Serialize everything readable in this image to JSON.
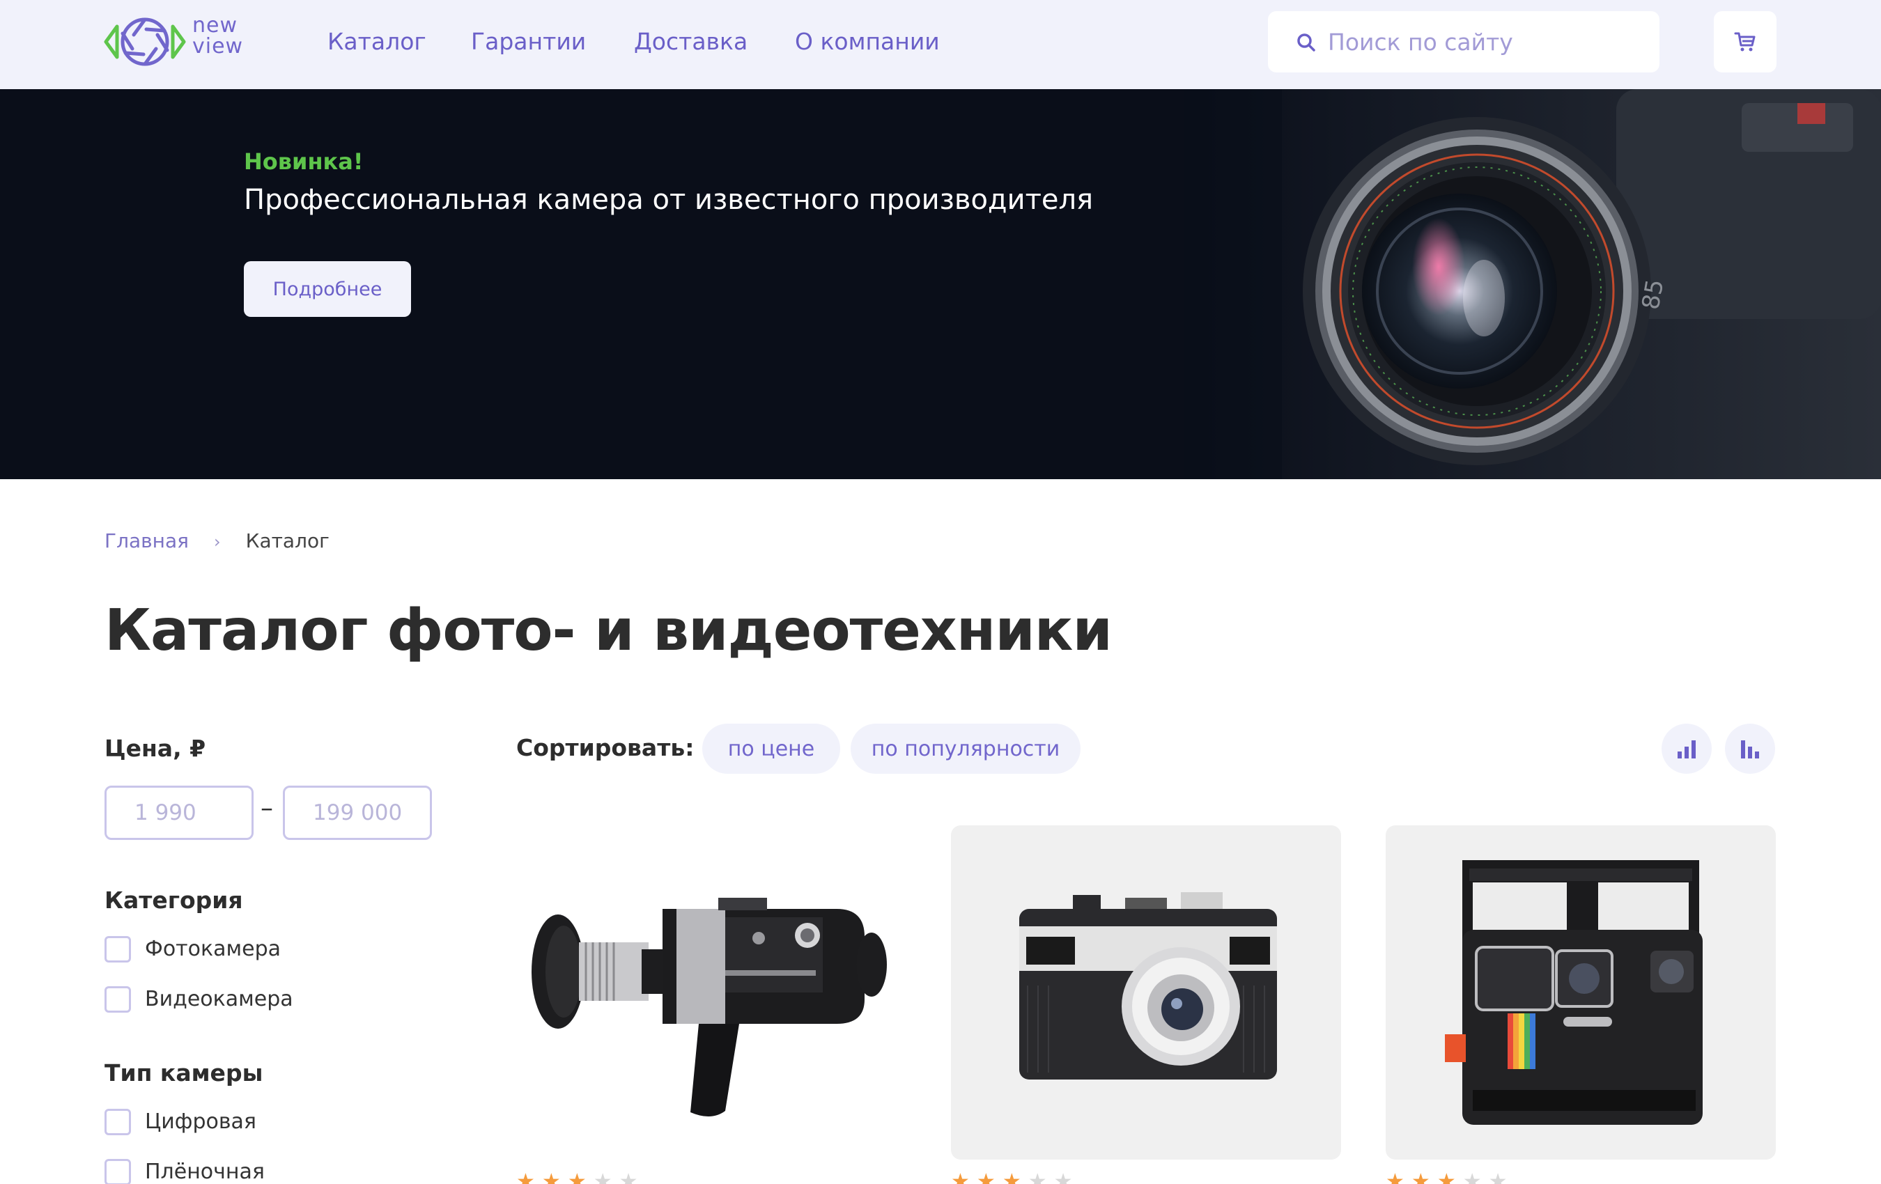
{
  "header": {
    "logo": {
      "line1": "new",
      "line2": "view"
    },
    "nav": [
      {
        "label": "Каталог"
      },
      {
        "label": "Гарантии"
      },
      {
        "label": "Доставка"
      },
      {
        "label": "О компании"
      }
    ],
    "search": {
      "placeholder": "Поиск по сайту",
      "icon": "search-icon"
    },
    "cart": {
      "icon": "cart-icon"
    }
  },
  "hero": {
    "label": "Новинка!",
    "title": "Профессиональная камера от известного производителя",
    "button": "Подробнее",
    "lens_marking": "85"
  },
  "breadcrumb": {
    "home": "Главная",
    "separator": "›",
    "current": "Каталог"
  },
  "page_title": "Каталог фото- и видеотехники",
  "filters": {
    "price": {
      "heading": "Цена, ₽",
      "min_placeholder": "1 990",
      "max_placeholder": "199 000",
      "dash": "–"
    },
    "category": {
      "heading": "Категория",
      "options": [
        {
          "label": "Фотокамера",
          "checked": false
        },
        {
          "label": "Видеокамера",
          "checked": false
        }
      ]
    },
    "camera_type": {
      "heading": "Тип камеры",
      "options": [
        {
          "label": "Цифровая",
          "checked": false
        },
        {
          "label": "Плёночная",
          "checked": false
        }
      ]
    }
  },
  "sort": {
    "label": "Сортировать:",
    "options": [
      {
        "label": "по цене"
      },
      {
        "label": "по популярности"
      }
    ],
    "view_buttons": [
      {
        "icon": "sort-ascending-bars-icon"
      },
      {
        "icon": "sort-descending-bars-icon"
      }
    ]
  },
  "products": [
    {
      "image": "vintage-movie-camera",
      "rating": 3,
      "max_rating": 5
    },
    {
      "image": "compact-film-camera",
      "rating": 3,
      "max_rating": 5
    },
    {
      "image": "instant-camera",
      "rating": 3,
      "max_rating": 5
    }
  ],
  "colors": {
    "accent": "#6a5fc8",
    "header_bg": "#f1f2fb",
    "hero_bg": "#0a0e19",
    "highlight_green": "#5ec54b",
    "star": "#f59b3c"
  }
}
